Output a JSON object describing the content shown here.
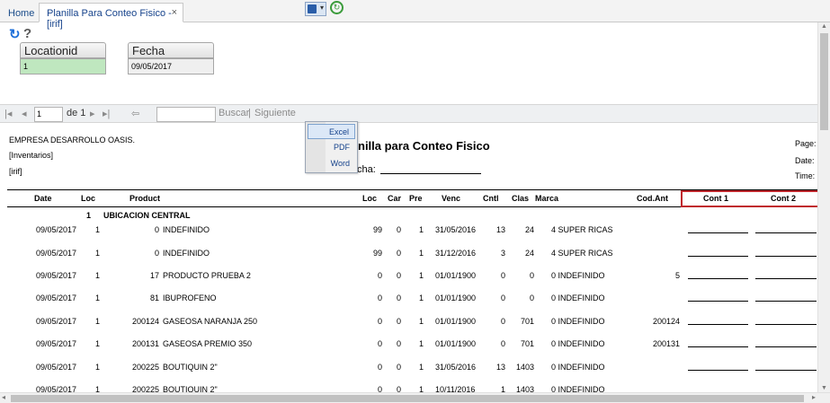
{
  "tabs": {
    "home": "Home",
    "active": "Planilla Para Conteo Fisico -[irif]",
    "close": "×"
  },
  "form": {
    "locationid_label": "Locationid",
    "locationid_value": "1",
    "fecha_label": "Fecha",
    "fecha_value": "09/05/2017"
  },
  "toolbar": {
    "page_value": "1",
    "of_pages": "de 1",
    "search_value": "",
    "find": "Buscar",
    "sep": "|",
    "next": "Siguiente",
    "export_menu": [
      "Excel",
      "PDF",
      "Word"
    ]
  },
  "report": {
    "company": "EMPRESA DESARROLLO OASIS.",
    "module": "[Inventarios]",
    "code": "[irif]",
    "title": "nilla para Conteo Fisico",
    "fecha": "cha:",
    "page_lbl": "Page:",
    "date_lbl": "Date:",
    "time_lbl": "Time:",
    "headers": [
      "Date",
      "Loc",
      "Product",
      "Loc",
      "Car",
      "Pre",
      "Venc",
      "Cntl",
      "Clas",
      "Marca",
      "Cod.Ant",
      "Cont 1",
      "Cont 2"
    ],
    "group_num": "1",
    "group_name": "UBICACION CENTRAL",
    "rows": [
      [
        "09/05/2017",
        "1",
        "0",
        "INDEFINIDO",
        "99",
        "0",
        "1",
        "31/05/2016",
        "13",
        "24",
        "4 SUPER RICAS",
        ""
      ],
      [
        "09/05/2017",
        "1",
        "0",
        "INDEFINIDO",
        "99",
        "0",
        "1",
        "31/12/2016",
        "3",
        "24",
        "4 SUPER RICAS",
        ""
      ],
      [
        "09/05/2017",
        "1",
        "17",
        "PRODUCTO PRUEBA 2",
        "0",
        "0",
        "1",
        "01/01/1900",
        "0",
        "0",
        "0 INDEFINIDO",
        "5"
      ],
      [
        "09/05/2017",
        "1",
        "81",
        "IBUPROFENO",
        "0",
        "0",
        "1",
        "01/01/1900",
        "0",
        "0",
        "0 INDEFINIDO",
        ""
      ],
      [
        "09/05/2017",
        "1",
        "200124",
        "GASEOSA NARANJA 250",
        "0",
        "0",
        "1",
        "01/01/1900",
        "0",
        "701",
        "0 INDEFINIDO",
        "200124"
      ],
      [
        "09/05/2017",
        "1",
        "200131",
        "GASEOSA PREMIO 350",
        "0",
        "0",
        "1",
        "01/01/1900",
        "0",
        "701",
        "0 INDEFINIDO",
        "200131"
      ],
      [
        "09/05/2017",
        "1",
        "200225",
        "BOUTIQUIN 2\"",
        "0",
        "0",
        "1",
        "31/05/2016",
        "13",
        "1403",
        "0 INDEFINIDO",
        ""
      ],
      [
        "09/05/2017",
        "1",
        "200225",
        "BOUTIQUIN 2\"",
        "0",
        "0",
        "1",
        "10/11/2016",
        "1",
        "1403",
        "0 INDEFINIDO",
        ""
      ]
    ]
  }
}
